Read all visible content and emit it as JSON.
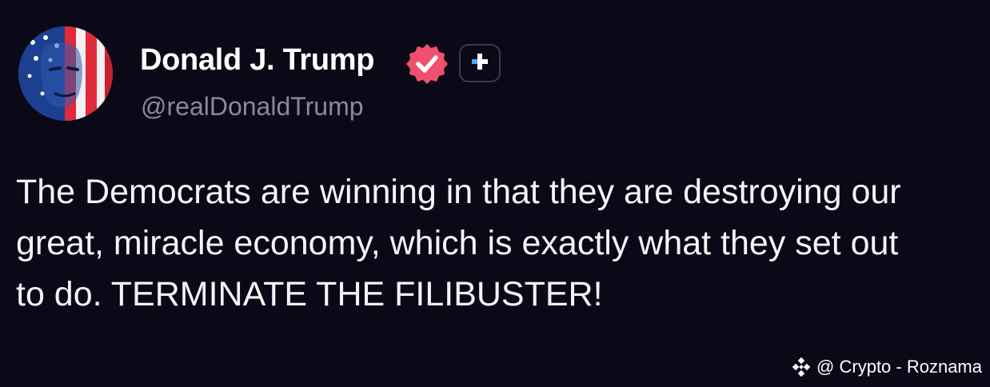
{
  "post": {
    "author": {
      "display_name": "Donald J. Trump",
      "handle": "@realDonaldTrump",
      "avatar_icon": "flag-painted-face-avatar",
      "verified_icon": "verified-badge-icon",
      "verified_color": "#f0506e",
      "subscribe_icon": "plus-icon"
    },
    "text": "The Democrats are winning in that they are destroying our great, miracle economy, which is exactly what they set out to do. TERMINATE THE FILIBUSTER!"
  },
  "watermark": {
    "icon": "diamond-logo-icon",
    "label": "@ Crypto - Roznama"
  },
  "colors": {
    "background": "#0b0818",
    "text": "#f4f4f6",
    "muted_text": "#8b8996",
    "plus_accent": "#4aa8ff"
  }
}
